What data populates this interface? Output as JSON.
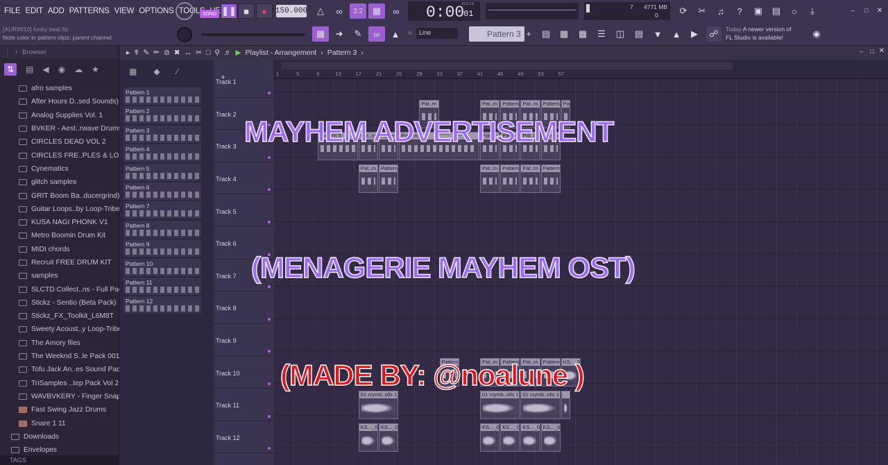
{
  "menu": [
    "FILE",
    "EDIT",
    "ADD",
    "PATTERNS",
    "VIEW",
    "OPTIONS",
    "TOOLS",
    "HELP"
  ],
  "transport": {
    "mode_label": "SONG",
    "tempo": "150.000",
    "time": "0:00",
    "time_sub": "01",
    "time_unit": "M:S:CS",
    "cpu_value": "7",
    "memory": "4771 MB",
    "cpu_poly": "0"
  },
  "snap": {
    "label": "Line"
  },
  "pattern_selector": {
    "value": "Pattern 3"
  },
  "hint": {
    "project": "[AUR9910] funky beat.flp",
    "message": "Note color in pattern clips: parent channel"
  },
  "news": {
    "label": "Today",
    "line1": "A newer version of",
    "line2": "FL Studio is available!"
  },
  "browser": {
    "title": "Browser",
    "items": [
      {
        "label": "afro samples",
        "kind": "folder"
      },
      {
        "label": "After Hours D..sed Sounds)",
        "kind": "folder"
      },
      {
        "label": "Analog Supplies Vol. 1",
        "kind": "folder"
      },
      {
        "label": "BVKER - Aest..rwave Drums",
        "kind": "folder"
      },
      {
        "label": "CIRCLES DEAD VOL 2",
        "kind": "folder"
      },
      {
        "label": "CIRCLES FRE..PLES & LOOPS",
        "kind": "folder"
      },
      {
        "label": "Cynematics",
        "kind": "folder"
      },
      {
        "label": "glitch samples",
        "kind": "folder"
      },
      {
        "label": "GRIT Boom Ba..ducergrind)",
        "kind": "folder"
      },
      {
        "label": "Guitar Loops..by Loop-Tribe",
        "kind": "folder"
      },
      {
        "label": "KUSA NAGI PHONK V1",
        "kind": "folder"
      },
      {
        "label": "Metro Boomin Drum Kit",
        "kind": "folder"
      },
      {
        "label": "MIDI chords",
        "kind": "folder"
      },
      {
        "label": "Recruit FREE DRUM KIT",
        "kind": "folder"
      },
      {
        "label": "samples",
        "kind": "folder"
      },
      {
        "label": "SLCTD Collect..ns - Full Pack",
        "kind": "folder"
      },
      {
        "label": "Stickz - Sentio (Beta Pack)",
        "kind": "folder"
      },
      {
        "label": "Stickz_FX_Toolkit_L6M8T",
        "kind": "folder"
      },
      {
        "label": "Sweety Acoust..y Loop-Tribe",
        "kind": "folder"
      },
      {
        "label": "The Amory files",
        "kind": "folder"
      },
      {
        "label": "The Weeknd S..le Pack 001",
        "kind": "folder"
      },
      {
        "label": "Tofu Jack An..es Sound Pack",
        "kind": "folder"
      },
      {
        "label": "TriSamples ..tep Pack Vol 2",
        "kind": "folder"
      },
      {
        "label": "WAVBVKERY - Finger Snaps",
        "kind": "folder"
      },
      {
        "label": "Fast Swing Jazz Drums",
        "kind": "file"
      },
      {
        "label": "Snare 1 11",
        "kind": "file"
      },
      {
        "label": "Downloads",
        "kind": "root"
      },
      {
        "label": "Envelopes",
        "kind": "root"
      }
    ],
    "tags_label": "TAGS"
  },
  "playlist": {
    "title": "Playlist - Arrangement",
    "breadcrumb": "Pattern 3",
    "patterns": [
      "Pattern 1",
      "Pattern 2",
      "Pattern 3",
      "Pattern 4",
      "Pattern 5",
      "Pattern 6",
      "Pattern 7",
      "Pattern 8",
      "Pattern 9",
      "Pattern 10",
      "Pattern 11",
      "Pattern 12"
    ],
    "tracks": [
      "Track 1",
      "Track 2",
      "Track 3",
      "Track 4",
      "Track 5",
      "Track 6",
      "Track 7",
      "Track 8",
      "Track 9",
      "Track 10",
      "Track 11",
      "Track 12"
    ],
    "bar_numbers": [
      "1",
      "5",
      "9",
      "13",
      "17",
      "21",
      "25",
      "29",
      "33",
      "37",
      "41",
      "45",
      "49",
      "53",
      "57"
    ],
    "clips": [
      {
        "track": 2,
        "start": 29,
        "len": 4,
        "label": "Pat..rn 2"
      },
      {
        "track": 2,
        "start": 41,
        "len": 4,
        "label": "Pat..rn 2"
      },
      {
        "track": 2,
        "start": 45,
        "len": 4,
        "label": "Pattern 2"
      },
      {
        "track": 2,
        "start": 49,
        "len": 4,
        "label": "Pat..rn 2"
      },
      {
        "track": 2,
        "start": 53,
        "len": 4,
        "label": "Pattern 2"
      },
      {
        "track": 2,
        "start": 57,
        "len": 2,
        "label": "Pa"
      },
      {
        "track": 3,
        "start": 9,
        "len": 8,
        "label": "Pattern 3"
      },
      {
        "track": 3,
        "start": 17,
        "len": 4,
        "label": "Pat..rn 3"
      },
      {
        "track": 3,
        "start": 21,
        "len": 4,
        "label": "Pattern 3"
      },
      {
        "track": 3,
        "start": 25,
        "len": 16,
        "label": "Pattern 10"
      },
      {
        "track": 3,
        "start": 41,
        "len": 4,
        "label": "Pat..rn 3"
      },
      {
        "track": 3,
        "start": 45,
        "len": 4,
        "label": "Pattern 3"
      },
      {
        "track": 3,
        "start": 49,
        "len": 4,
        "label": "Pat..rn 3"
      },
      {
        "track": 3,
        "start": 53,
        "len": 4,
        "label": "Pattern 3"
      },
      {
        "track": 4,
        "start": 17,
        "len": 4,
        "label": "Pat..rn 4"
      },
      {
        "track": 4,
        "start": 21,
        "len": 4,
        "label": "Pattern 4"
      },
      {
        "track": 4,
        "start": 41,
        "len": 4,
        "label": "Pat..rn 4"
      },
      {
        "track": 4,
        "start": 45,
        "len": 4,
        "label": "Pattern 4"
      },
      {
        "track": 4,
        "start": 49,
        "len": 4,
        "label": "Pat..rn 4"
      },
      {
        "track": 4,
        "start": 53,
        "len": 4,
        "label": "Pattern 4"
      },
      {
        "track": 10,
        "start": 41,
        "len": 4,
        "label": "Pat..rn 7"
      },
      {
        "track": 10,
        "start": 45,
        "len": 4,
        "label": "Pattern 7"
      },
      {
        "track": 10,
        "start": 49,
        "len": 4,
        "label": "Pat..rn 7"
      },
      {
        "track": 10,
        "start": 53,
        "len": 4,
        "label": "Pattern 7"
      },
      {
        "track": 10,
        "start": 33,
        "len": 4,
        "label": "Pattern 7"
      },
      {
        "track": 10,
        "start": 57,
        "len": 4,
        "label": "KS..._09",
        "audio": true
      },
      {
        "track": 11,
        "start": 17,
        "len": 8,
        "label": "01 crymb..olls 1",
        "audio": true
      },
      {
        "track": 11,
        "start": 41,
        "len": 8,
        "label": "01 crymb..olls 1",
        "audio": true
      },
      {
        "track": 11,
        "start": 49,
        "len": 8,
        "label": "01 crymb..olls 1",
        "audio": true
      },
      {
        "track": 11,
        "start": 57,
        "len": 2,
        "label": "",
        "audio": true
      },
      {
        "track": 12,
        "start": 17,
        "len": 4,
        "label": "KS..._09",
        "audio": true
      },
      {
        "track": 12,
        "start": 21,
        "len": 4,
        "label": "KS..._09",
        "audio": true
      },
      {
        "track": 12,
        "start": 41,
        "len": 4,
        "label": "KS..._09",
        "audio": true
      },
      {
        "track": 12,
        "start": 45,
        "len": 4,
        "label": "KS..._09",
        "audio": true
      },
      {
        "track": 12,
        "start": 49,
        "len": 4,
        "label": "KS..._09",
        "audio": true
      },
      {
        "track": 12,
        "start": 53,
        "len": 4,
        "label": "KS..._09",
        "audio": true
      }
    ]
  },
  "overlay": {
    "title": "MAYHEM ADVERTISEMENT",
    "subtitle": "(MENAGERIE MAYHEM OST)",
    "credit": "(MADE BY: @noalune )"
  }
}
